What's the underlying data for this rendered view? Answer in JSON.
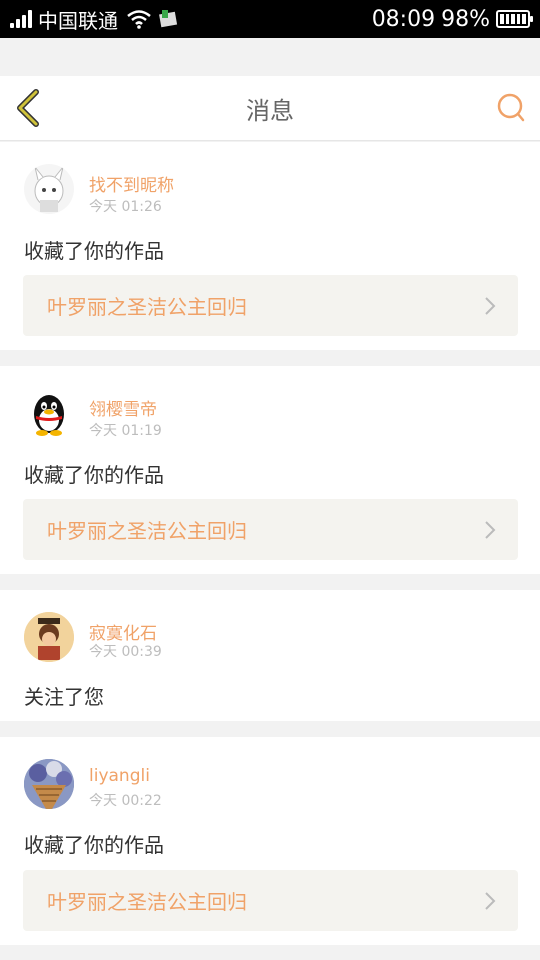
{
  "status_bar": {
    "carrier": "中国联通",
    "time": "08:09",
    "battery": "98%"
  },
  "header": {
    "title": "消息",
    "back_icon": "chevron-left-icon",
    "search_icon": "search-icon"
  },
  "colors": {
    "accent": "#f0a268",
    "back_icon": "#cfc23a",
    "background": "#f2f2f2"
  },
  "messages": [
    {
      "user": "找不到昵称",
      "time": "今天 01:26",
      "action": "收藏了你的作品",
      "work": "叶罗丽之圣洁公主回归"
    },
    {
      "user": "翎樱雪帝",
      "time": "今天 01:19",
      "action": "收藏了你的作品",
      "work": "叶罗丽之圣洁公主回归"
    },
    {
      "user": "寂寞化石",
      "time": "今天 00:39",
      "action": "关注了您"
    },
    {
      "user": "liyangli",
      "time": "今天 00:22",
      "action": "收藏了你的作品",
      "work": "叶罗丽之圣洁公主回归"
    }
  ]
}
